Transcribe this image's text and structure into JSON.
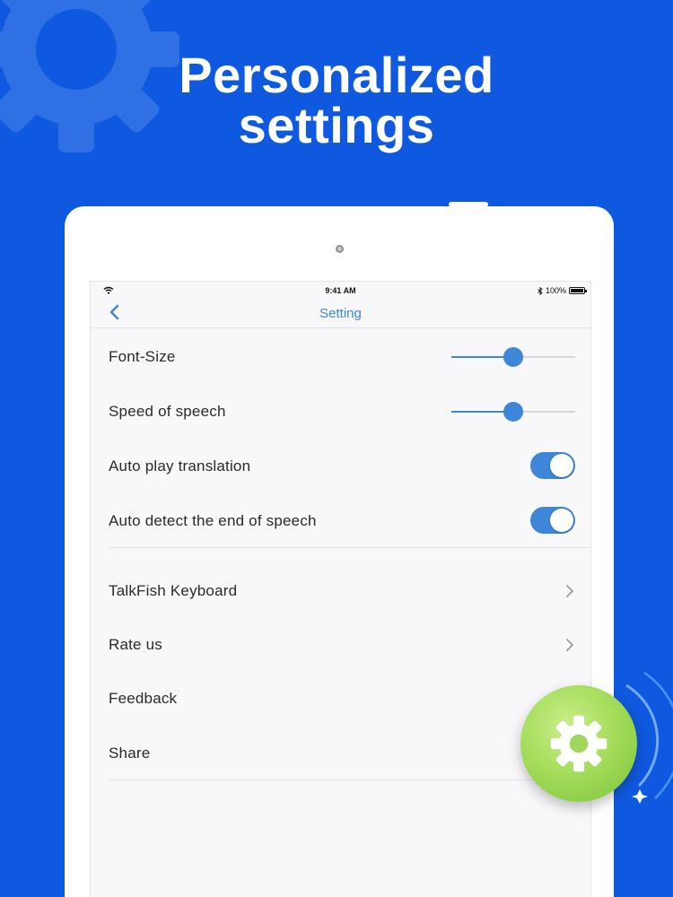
{
  "promo": {
    "headline_line1": "Personalized",
    "headline_line2": "settings"
  },
  "status_bar": {
    "time": "9:41 AM",
    "battery": "100%"
  },
  "navbar": {
    "title": "Setting"
  },
  "settings": {
    "font_size": {
      "label": "Font-Size",
      "value": 0.5
    },
    "speed": {
      "label": "Speed of speech",
      "value": 0.5
    },
    "auto_play": {
      "label": "Auto play translation",
      "on": true
    },
    "auto_detect": {
      "label": "Auto detect the end of speech",
      "on": true
    }
  },
  "links": {
    "keyboard": "TalkFish Keyboard",
    "rate": "Rate us",
    "feedback": "Feedback",
    "share": "Share"
  },
  "colors": {
    "background": "#0f59e0",
    "accent": "#3d86d8",
    "fab": "#a6dd5c"
  },
  "icons": [
    "gear-icon",
    "back-chevron-icon",
    "chevron-right-icon",
    "wifi-icon",
    "bluetooth-icon",
    "battery-icon"
  ]
}
